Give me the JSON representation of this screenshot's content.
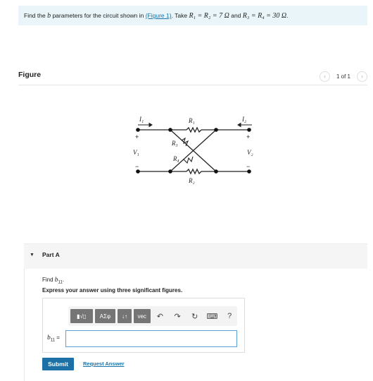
{
  "problem": {
    "text_before": "Find the ",
    "b_symbol": "b",
    "text_mid": " parameters for the circuit shown in ",
    "figure_link": "(Figure 1)",
    "text_take": ". Take ",
    "eq1": "R₁ = R₂ = 7 Ω",
    "text_and": " and ",
    "eq2": "R₃ = R₄ = 30 Ω",
    "text_end": "."
  },
  "figure": {
    "title": "Figure",
    "pager": "1 of 1",
    "prev_icon": "chevron-left-icon",
    "next_icon": "chevron-right-icon"
  },
  "circuit": {
    "I1": "I₁",
    "I2": "I₂",
    "V1": "V₁",
    "V2": "V₂",
    "R1": "R₁",
    "R2": "R₂",
    "R3": "R₃",
    "R4": "R₄",
    "plus": "+",
    "minus": "−"
  },
  "part": {
    "title": "Part A",
    "find_text": "Find ",
    "find_var": "b",
    "find_sub": "11",
    "find_end": ".",
    "instruction": "Express your answer using three significant figures.",
    "answer_label_var": "b",
    "answer_label_sub": "11",
    "answer_label_eq": " =",
    "answer_value": ""
  },
  "toolbar": {
    "templates_label": "▮√▯",
    "symbols_label": "ΑΣφ",
    "updown_label": "↓↑",
    "vec_label": "vec",
    "undo_icon": "↶",
    "redo_icon": "↷",
    "reset_icon": "↻",
    "keyboard_icon": "⌨",
    "help_icon": "?"
  },
  "buttons": {
    "submit": "Submit",
    "request": "Request Answer"
  }
}
